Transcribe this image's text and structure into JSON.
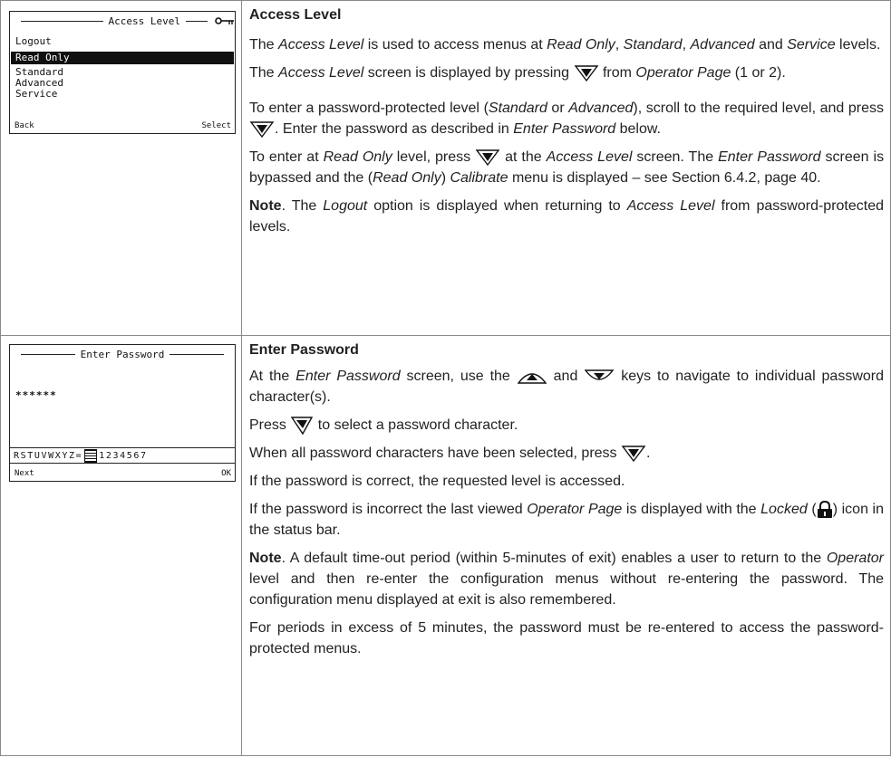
{
  "section1": {
    "screen": {
      "title": "Access Level",
      "items": [
        "Logout",
        "Read Only",
        "Standard",
        "Advanced",
        "Service"
      ],
      "selected": "Read Only",
      "left_soft": "Back",
      "right_soft": "Select"
    },
    "heading": "Access Level",
    "p1_a": "The ",
    "p1_b": "Access Level",
    "p1_c": " is used to access menus at ",
    "p1_d": "Read Only",
    "p1_e": ", ",
    "p1_f": "Standard",
    "p1_g": ", ",
    "p1_h": "Advanced",
    "p1_i": " and ",
    "p1_j": "Service",
    "p1_k": " levels.",
    "p2_a": "The ",
    "p2_b": "Access Level",
    "p2_c": " screen is displayed by pressing ",
    "p2_d": " from ",
    "p2_e": "Operator Page",
    "p2_f": " (1 or 2).",
    "p3_a": "To enter a password-protected level (",
    "p3_b": "Standard",
    "p3_c": " or ",
    "p3_d": "Advanced",
    "p3_e": "), scroll to the required level, and press ",
    "p3_f": ". Enter the password as described in ",
    "p3_g": "Enter Password",
    "p3_h": " below.",
    "p4_a": "To enter at ",
    "p4_b": "Read Only",
    "p4_c": " level, press ",
    "p4_d": " at the ",
    "p4_e": "Access Level",
    "p4_f": " screen. The ",
    "p4_g": "Enter Password",
    "p4_h": " screen is bypassed and the (",
    "p4_i": "Read Only",
    "p4_j": ") ",
    "p4_k": "Calibrate",
    "p4_l": " menu is displayed – see Section 6.4.2, page 40.",
    "note_label": "Note",
    "p5_a": ". The ",
    "p5_b": "Logout",
    "p5_c": " option is displayed when returning to ",
    "p5_d": "Access Level",
    "p5_e": " from password-protected levels."
  },
  "section2": {
    "screen": {
      "title": "Enter Password",
      "masked": "******",
      "chars_left": "RSTUVWXYZ=",
      "chars_right": "1234567",
      "left_soft": "Next",
      "right_soft": "OK"
    },
    "heading": "Enter Password",
    "q1_a": "At the ",
    "q1_b": "Enter Password",
    "q1_c": " screen, use the ",
    "q1_d": " and ",
    "q1_e": " keys to navigate to individual password character(s).",
    "q2_a": "Press ",
    "q2_b": " to select a password character.",
    "q3_a": "When all password characters have been selected, press ",
    "q3_b": ".",
    "q4": "If the password is correct, the requested level is accessed.",
    "q5_a": "If the password is incorrect the last viewed ",
    "q5_b": "Operator Page",
    "q5_c": " is displayed with the ",
    "q5_d": "Locked",
    "q5_e": " (",
    "q5_f": ") icon in the status bar.",
    "note_label": "Note",
    "q6_a": ". A default time-out period (within 5-minutes of exit) enables a user to return to the ",
    "q6_b": "Operator",
    "q6_c": " level and then re-enter the configuration menus without re-entering the password. The configuration menu displayed at exit is also remembered.",
    "q7": "For periods in excess of 5 minutes, the password must be re-entered to access the password-protected menus."
  },
  "icons": [
    "key-icon",
    "right-key-icon",
    "up-key-icon",
    "down-key-icon",
    "select-key-icon",
    "locked-icon"
  ]
}
